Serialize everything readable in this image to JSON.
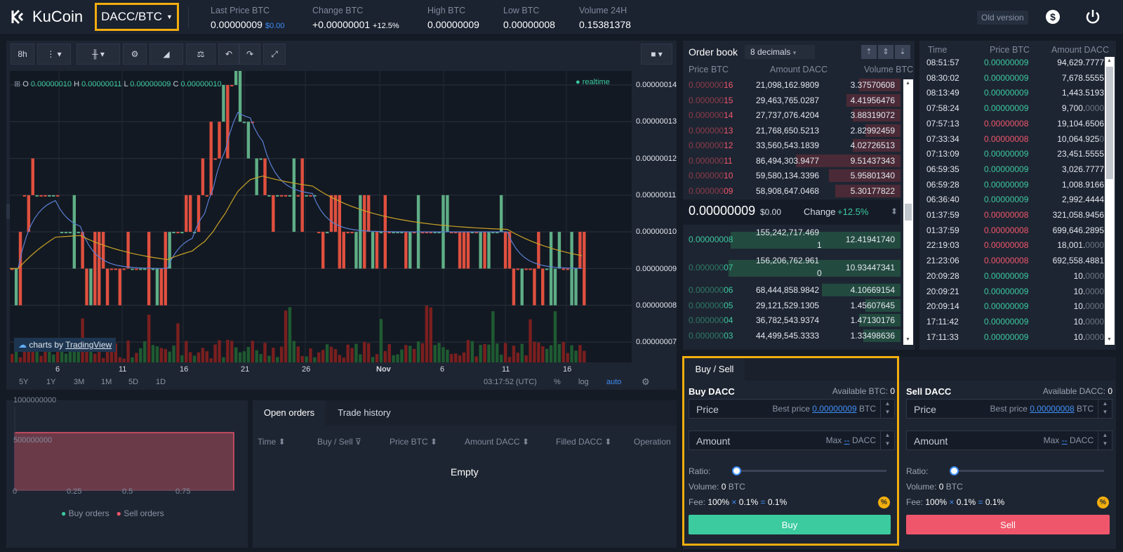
{
  "header": {
    "brand": "KuCoin",
    "pair": "DACC/BTC",
    "stats": [
      {
        "label": "Last Price BTC",
        "value": "0.00000009",
        "sub": "$0.00"
      },
      {
        "label": "Change BTC",
        "value": "+0.00000001",
        "sub": "+12.5%"
      },
      {
        "label": "High BTC",
        "value": "0.00000009"
      },
      {
        "label": "Low BTC",
        "value": "0.00000008"
      },
      {
        "label": "Volume 24H",
        "value": "0.15381378"
      }
    ],
    "old_version": "Old version"
  },
  "chart": {
    "interval": "8h",
    "ohlc": {
      "o_label": "O",
      "o": "0.00000010",
      "h_label": "H",
      "h": "0.00000011",
      "l_label": "L",
      "l": "0.00000009",
      "c_label": "C",
      "c": "0.00000010"
    },
    "realtime": "realtime",
    "attribution_prefix": "charts by",
    "attribution_link": "TradingView",
    "y_ticks": [
      "0.00000014",
      "0.00000013",
      "0.00000012",
      "0.00000011",
      "0.00000010",
      "0.00000009",
      "0.00000008",
      "0.00000007"
    ],
    "x_ticks": [
      "6",
      "11",
      "16",
      "21",
      "26",
      "Nov",
      "6",
      "11",
      "16"
    ],
    "ranges": [
      "5Y",
      "1Y",
      "3M",
      "1M",
      "5D",
      "1D"
    ],
    "time": "03:17:52 (UTC)",
    "pct": "%",
    "log": "log",
    "auto": "auto"
  },
  "chart_data": {
    "type": "bar",
    "title": "",
    "ylim": [
      7e-08,
      1.4e-07
    ],
    "categories": [
      "6",
      "11",
      "16",
      "21",
      "26",
      "Nov",
      "6",
      "11",
      "16"
    ],
    "series": [
      {
        "values": [
          1.1e-07,
          1e-07,
          9e-08,
          1.2e-07,
          1.1e-07,
          1e-07,
          1e-07,
          1e-07,
          9e-08
        ]
      }
    ]
  },
  "depth": {
    "y_ticks": [
      "1000000000",
      "500000000"
    ],
    "x_ticks": [
      "0",
      "0.25",
      "0.5",
      "0.75"
    ],
    "buy_legend": "Buy orders",
    "sell_legend": "Sell orders"
  },
  "orders": {
    "tabs": [
      "Open orders",
      "Trade history"
    ],
    "columns": [
      "Time",
      "Buy / Sell",
      "Price BTC",
      "Amount DACC",
      "Filled DACC",
      "Operation"
    ],
    "empty": "Empty"
  },
  "orderbook": {
    "title": "Order book",
    "decimals": "8 decimals",
    "columns": [
      "Price BTC",
      "Amount DACC",
      "Volume BTC"
    ],
    "asks": [
      {
        "p1": "0.000000",
        "p2": "16",
        "amount": "21,098,162.9809",
        "vol": "3.37570608",
        "depth": 0.19
      },
      {
        "p1": "0.000000",
        "p2": "15",
        "amount": "29,463,765.0287",
        "vol": "4.41956476",
        "depth": 0.25
      },
      {
        "p1": "0.000000",
        "p2": "14",
        "amount": "27,737,076.4204",
        "vol": "3.88319072",
        "depth": 0.22
      },
      {
        "p1": "0.000000",
        "p2": "13",
        "amount": "21,768,650.5213",
        "vol": "2.82992459",
        "depth": 0.16
      },
      {
        "p1": "0.000000",
        "p2": "12",
        "amount": "33,560,543.1839",
        "vol": "4.02726513",
        "depth": 0.22
      },
      {
        "p1": "0.000000",
        "p2": "11",
        "amount": "86,494,303.9477",
        "vol": "9.51437343",
        "depth": 0.48
      },
      {
        "p1": "0.000000",
        "p2": "10",
        "amount": "59,580,134.3396",
        "vol": "5.95801340",
        "depth": 0.33
      },
      {
        "p1": "0.000000",
        "p2": "09",
        "amount": "58,908,647.0468",
        "vol": "5.30177822",
        "depth": 0.3
      }
    ],
    "last": "0.00000009",
    "last_usd": "$0.00",
    "change_label": "Change",
    "change": "+12.5%",
    "bids": [
      {
        "p1": "0.00000008",
        "p2": "",
        "amount_a": "155,242,717.469",
        "amount_b": "1",
        "vol": "12.41941740",
        "depth": 0.78
      },
      {
        "p1": "0.000000",
        "p2": "07",
        "amount_a": "156,206,762.961",
        "amount_b": "0",
        "vol": "10.93447341",
        "depth": 0.79
      },
      {
        "p1": "0.000000",
        "p2": "06",
        "amount": "68,444,858.9842",
        "vol": "4.10669154",
        "depth": 0.36
      },
      {
        "p1": "0.000000",
        "p2": "05",
        "amount": "29,121,529.1305",
        "vol": "1.45607645",
        "depth": 0.16
      },
      {
        "p1": "0.000000",
        "p2": "04",
        "amount": "36,782,543.9374",
        "vol": "1.47130176",
        "depth": 0.19
      },
      {
        "p1": "0.000000",
        "p2": "03",
        "amount": "44,499,545.3333",
        "vol": "1.33498636",
        "depth": 0.17
      }
    ]
  },
  "trades": {
    "columns": [
      "Time",
      "Price BTC",
      "Amount DACC"
    ],
    "rows": [
      {
        "t": "08:51:57",
        "p": "0.00000009",
        "s": "buy",
        "a": "94,629.7777",
        "z": ""
      },
      {
        "t": "08:30:02",
        "p": "0.00000009",
        "s": "buy",
        "a": "7,678.5555",
        "z": ""
      },
      {
        "t": "08:13:49",
        "p": "0.00000009",
        "s": "buy",
        "a": "1,443.5193",
        "z": ""
      },
      {
        "t": "07:58:24",
        "p": "0.00000009",
        "s": "buy",
        "a": "9,700.",
        "z": "0000"
      },
      {
        "t": "07:57:13",
        "p": "0.00000008",
        "s": "sell",
        "a": "19,104.6506",
        "z": ""
      },
      {
        "t": "07:33:34",
        "p": "0.00000008",
        "s": "sell",
        "a": "10,064.925",
        "z": "0"
      },
      {
        "t": "07:13:09",
        "p": "0.00000009",
        "s": "buy",
        "a": "23,451.5555",
        "z": ""
      },
      {
        "t": "06:59:35",
        "p": "0.00000009",
        "s": "buy",
        "a": "3,026.7777",
        "z": ""
      },
      {
        "t": "06:59:28",
        "p": "0.00000009",
        "s": "buy",
        "a": "1,008.9166",
        "z": ""
      },
      {
        "t": "06:36:40",
        "p": "0.00000009",
        "s": "buy",
        "a": "2,992.4444",
        "z": ""
      },
      {
        "t": "01:37:59",
        "p": "0.00000008",
        "s": "sell",
        "a": "321,058.9456",
        "z": ""
      },
      {
        "t": "01:37:59",
        "p": "0.00000008",
        "s": "sell",
        "a": "699,646.2895",
        "z": ""
      },
      {
        "t": "22:19:03",
        "p": "0.00000008",
        "s": "sell",
        "a": "18,001.",
        "z": "0000"
      },
      {
        "t": "21:23:06",
        "p": "0.00000008",
        "s": "sell",
        "a": "692,558.4881",
        "z": ""
      },
      {
        "t": "20:09:28",
        "p": "0.00000009",
        "s": "buy",
        "a": "10.",
        "z": "0000"
      },
      {
        "t": "20:09:21",
        "p": "0.00000009",
        "s": "buy",
        "a": "10.",
        "z": "0000"
      },
      {
        "t": "20:09:14",
        "p": "0.00000009",
        "s": "buy",
        "a": "10.",
        "z": "0000"
      },
      {
        "t": "17:11:42",
        "p": "0.00000009",
        "s": "buy",
        "a": "10.",
        "z": "0000"
      },
      {
        "t": "17:11:33",
        "p": "0.00000009",
        "s": "buy",
        "a": "10.",
        "z": "0000"
      }
    ]
  },
  "buysell": {
    "tab": "Buy / Sell",
    "buy": {
      "title": "Buy DACC",
      "available": "Available BTC:",
      "available_val": "0",
      "price": "Price",
      "best": "Best price",
      "best_val": "0.00000009",
      "unit": "BTC",
      "amount": "Amount",
      "max": "Max",
      "max_val": "--",
      "amount_unit": "DACC",
      "ratio": "Ratio:",
      "volume": "Volume:",
      "volume_val": "0",
      "volume_unit": "BTC",
      "fee": "Fee:",
      "fee_a": "100%",
      "x": "×",
      "fee_b": "0.1%",
      "eq": "=",
      "fee_c": "0.1%",
      "button": "Buy"
    },
    "sell": {
      "title": "Sell DACC",
      "available": "Available DACC:",
      "available_val": "0",
      "price": "Price",
      "best": "Best price",
      "best_val": "0.00000008",
      "unit": "BTC",
      "amount": "Amount",
      "max": "Max",
      "max_val": "--",
      "amount_unit": "DACC",
      "ratio": "Ratio:",
      "volume": "Volume:",
      "volume_val": "0",
      "volume_unit": "BTC",
      "fee": "Fee:",
      "fee_a": "100%",
      "x": "×",
      "fee_b": "0.1%",
      "eq": "=",
      "fee_c": "0.1%",
      "button": "Sell"
    },
    "ratio": 0,
    "colors": {
      "buy": "#3ccb9e",
      "sell": "#f0566b"
    }
  }
}
